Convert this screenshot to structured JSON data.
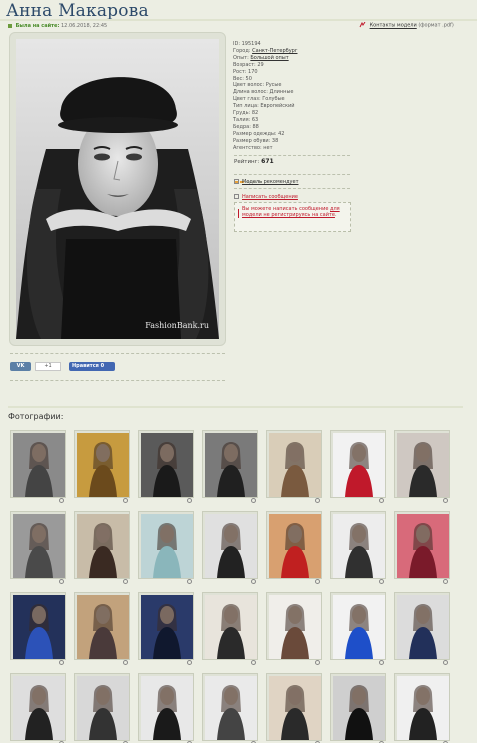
{
  "profile": {
    "name": "Анна Макарова",
    "last_seen_label": "Была на сайте:",
    "last_seen_value": "12.06.2018, 22:45",
    "contacts_link": "Контакты модели",
    "contacts_format": "(формат .pdf)",
    "watermark": "FashionBank.ru"
  },
  "info": {
    "id": "ID: 195194",
    "city_label": "Город:",
    "city_value": "Санкт-Петербург",
    "experience_label": "Опыт:",
    "experience_value": "Большой опыт",
    "age": "Возраст: 29",
    "height": "Рост: 170",
    "weight": "Вес: 50",
    "hair_color": "Цвет волос: Русые",
    "hair_length": "Длина волос: Длинные",
    "eye_color": "Цвет глаз: Голубые",
    "face_type": "Тип лица: Европейский",
    "chest": "Грудь: 82",
    "waist": "Талия: 63",
    "hips": "Бедра: 88",
    "clothing_size": "Размер одежды: 42",
    "shoe_size": "Размер обуви: 38",
    "agency": "Агентство: нет"
  },
  "rating": {
    "label": "Рейтинг:",
    "value": "671",
    "stars_filled": 2,
    "stars_total": 5
  },
  "links": {
    "recommend": "Модель рекомендует",
    "write_message": "Написать сообщение"
  },
  "message_box": {
    "text_before": "Вы можете написать сообщение",
    "link_text": "для модели не регистрируясь на сайте",
    "text_after": "."
  },
  "social": {
    "vk_label": "VK",
    "vk_count": "+1",
    "fb_label": "Нравится 0"
  },
  "photos_section": {
    "title": "Фотографии:",
    "count": 28
  },
  "colors": {
    "background": "#eceee3",
    "title": "#2d4a6a",
    "green_label": "#4a8c2a",
    "red_link": "#c0192b",
    "star_on": "#e8a33c",
    "vk": "#5b7fa6",
    "facebook": "#4267b2"
  },
  "icons": {
    "last_seen": "calendar-icon",
    "contacts": "pdf-icon",
    "recommend": "doc-icon",
    "write_message": "envelope-icon",
    "zoom": "magnifier-icon"
  }
}
